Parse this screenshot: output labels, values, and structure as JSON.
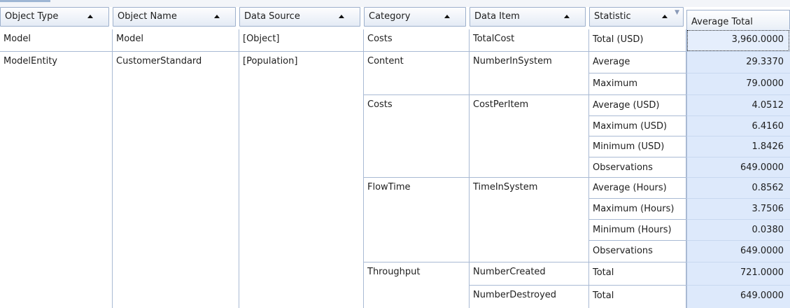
{
  "headers": [
    {
      "label": "Object Type"
    },
    {
      "label": "Object Name"
    },
    {
      "label": "Data Source"
    },
    {
      "label": "Category"
    },
    {
      "label": "Data Item"
    },
    {
      "label": "Statistic"
    }
  ],
  "value_header": "Average Total",
  "rows": {
    "object_type": [
      "Model",
      "ModelEntity"
    ],
    "object_name": [
      "Model",
      "CustomerStandard"
    ],
    "data_source": [
      "[Object]",
      "[Population]"
    ],
    "category": [
      "Costs",
      "Content",
      "Costs",
      "FlowTime",
      "Throughput"
    ],
    "data_item": [
      "TotalCost",
      "NumberInSystem",
      "CostPerItem",
      "TimeInSystem",
      "NumberCreated",
      "NumberDestroyed"
    ],
    "statistic": [
      "Total (USD)",
      "Average",
      "Maximum",
      "Average (USD)",
      "Maximum (USD)",
      "Minimum (USD)",
      "Observations",
      "Average (Hours)",
      "Maximum (Hours)",
      "Minimum (Hours)",
      "Observations",
      "Total",
      "Total"
    ],
    "value": [
      "3,960.0000",
      "29.3370",
      "79.0000",
      "4.0512",
      "6.4160",
      "1.8426",
      "649.0000",
      "0.8562",
      "3.7506",
      "0.0380",
      "649.0000",
      "721.0000",
      "649.0000"
    ]
  }
}
